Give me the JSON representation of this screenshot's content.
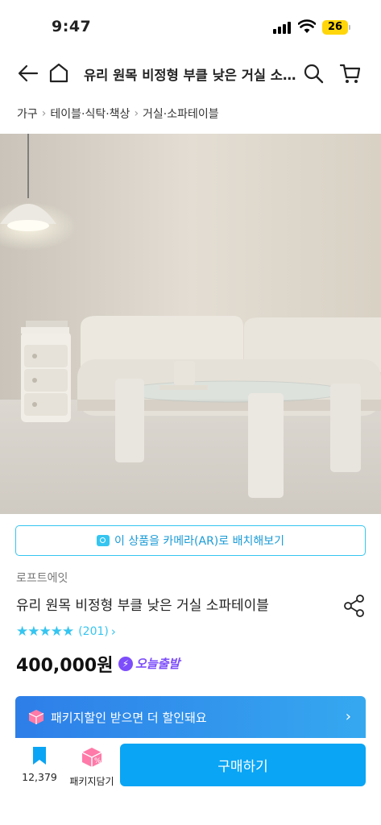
{
  "status_bar": {
    "time": "9:47",
    "battery": "26"
  },
  "nav": {
    "title": "유리 원목 비정형 부클 낮은 거실 소…"
  },
  "breadcrumb": [
    "가구",
    "테이블·식탁·책상",
    "거실·소파테이블"
  ],
  "ar_button": {
    "label": "이 상품을 카메라(AR)로 배치해보기"
  },
  "product": {
    "brand": "로프트에잇",
    "name": "유리 원목 비정형 부클 낮은 거실 소파테이블",
    "rating": {
      "stars": 5,
      "count": "(201)"
    },
    "price": "400,000원",
    "delivery_badge": "오늘출발"
  },
  "package_banner": {
    "label": "패키지할인 받으면 더 할인돼요"
  },
  "bottom_bar": {
    "scrap_count": "12,379",
    "package_label": "패키지담기",
    "buy_label": "구매하기"
  },
  "colors": {
    "accent": "#35c5f0",
    "buy": "#0aa5f5",
    "badge": "#7d4dfb"
  },
  "icons": [
    "back-arrow-icon",
    "home-icon",
    "search-icon",
    "cart-icon",
    "share-icon",
    "camera-icon",
    "bookmark-icon",
    "package-box-icon",
    "lightning-icon",
    "chevron-right-icon"
  ]
}
